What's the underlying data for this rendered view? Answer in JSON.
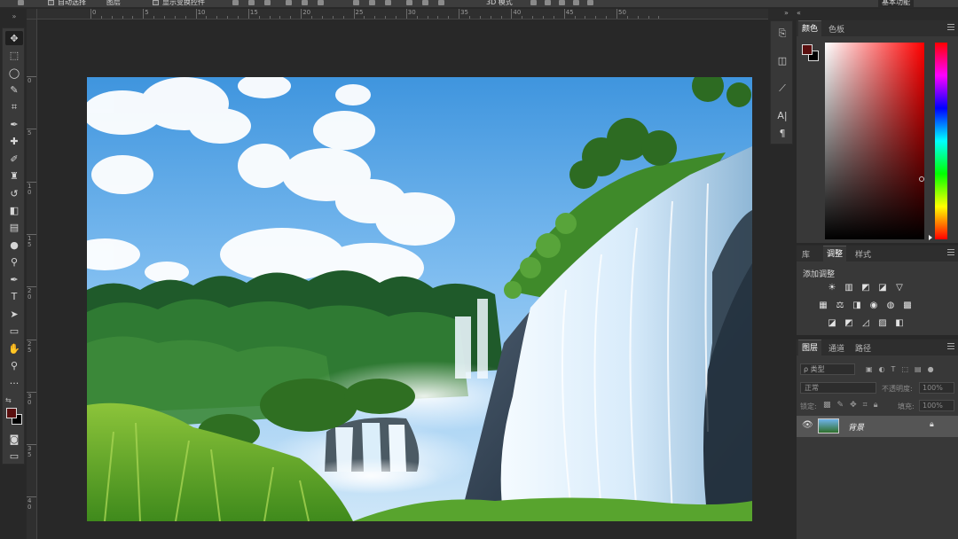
{
  "options_bar": {
    "auto_select_label": "自动选择",
    "auto_select_target": "图层",
    "show_transform_label": "显示变换控件",
    "mode_label": "3D 模式",
    "workspace": "基本功能"
  },
  "rulers": {
    "horizontal": [
      "0",
      "5",
      "10",
      "15",
      "20",
      "25",
      "30",
      "35",
      "40",
      "45",
      "50"
    ],
    "vertical": [
      "0",
      "5",
      "10",
      "15",
      "20",
      "25",
      "30",
      "35",
      "40"
    ]
  },
  "tools": [
    {
      "name": "move-tool",
      "glyph": "✥"
    },
    {
      "name": "marquee-tool",
      "glyph": "⬚"
    },
    {
      "name": "lasso-tool",
      "glyph": "◯"
    },
    {
      "name": "quick-select-tool",
      "glyph": "✎"
    },
    {
      "name": "crop-tool",
      "glyph": "⌗"
    },
    {
      "name": "eyedropper-tool",
      "glyph": "✒"
    },
    {
      "name": "healing-brush-tool",
      "glyph": "✚"
    },
    {
      "name": "brush-tool",
      "glyph": "✐"
    },
    {
      "name": "clone-stamp-tool",
      "glyph": "♜"
    },
    {
      "name": "history-brush-tool",
      "glyph": "↺"
    },
    {
      "name": "eraser-tool",
      "glyph": "◧"
    },
    {
      "name": "gradient-tool",
      "glyph": "▤"
    },
    {
      "name": "blur-tool",
      "glyph": "●"
    },
    {
      "name": "dodge-tool",
      "glyph": "⚲"
    },
    {
      "name": "pen-tool",
      "glyph": "✒"
    },
    {
      "name": "type-tool",
      "glyph": "T"
    },
    {
      "name": "path-select-tool",
      "glyph": "➤"
    },
    {
      "name": "rectangle-tool",
      "glyph": "▭"
    },
    {
      "name": "hand-tool",
      "glyph": "✋"
    },
    {
      "name": "zoom-tool",
      "glyph": "⚲"
    },
    {
      "name": "more-tools",
      "glyph": "···"
    }
  ],
  "colors": {
    "foreground": "#5a0f0f",
    "background": "#000000"
  },
  "panels": {
    "color_panel": {
      "tabs": [
        "颜色",
        "色板"
      ],
      "active": "颜色"
    },
    "adjustments_panel": {
      "tabs": [
        "库",
        "调整",
        "样式"
      ],
      "active": "调整",
      "heading": "添加调整",
      "row1": [
        "☀",
        "▥",
        "◩",
        "◪",
        "▽"
      ],
      "row2": [
        "▦",
        "⚖",
        "◨",
        "◉",
        "◍",
        "▩"
      ],
      "row3": [
        "◪",
        "◩",
        "◿",
        "▨",
        "◧"
      ]
    },
    "layers_panel": {
      "tabs": [
        "图层",
        "通道",
        "路径"
      ],
      "active": "图层",
      "filter_label": "ρ 类型",
      "blend_mode": "正常",
      "opacity_label": "不透明度:",
      "opacity_value": "100%",
      "lock_label": "锁定:",
      "fill_label": "填充:",
      "fill_value": "100%",
      "layers": [
        {
          "name": "背景",
          "visible": true,
          "locked": true
        }
      ]
    }
  }
}
